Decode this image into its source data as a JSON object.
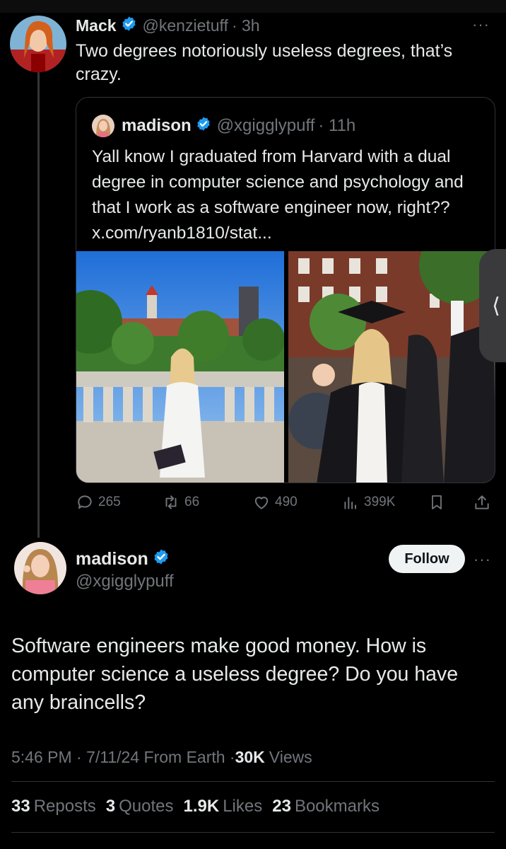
{
  "colors": {
    "accent": "#1d9bf0",
    "text": "#e7e9ea",
    "muted": "#71767b",
    "border": "#2f3336",
    "background": "#000000"
  },
  "tweet1": {
    "name": "Mack",
    "handle": "@kenzietuff",
    "time": "· 3h",
    "more": "···",
    "text": "Two degrees notoriously useless degrees, that’s crazy."
  },
  "quote": {
    "name": "madison",
    "handle": "@xgigglypuff",
    "time": "· 11h",
    "text": "Yall know I graduated from Harvard with a dual degree in computer science and psychology and that I work as a software engineer now, right?? x.com/ryanb1810/stat..."
  },
  "actions": {
    "replies": "265",
    "reposts": "66",
    "likes": "490",
    "views": "399K",
    "icons": [
      "reply-icon",
      "repost-icon",
      "like-icon",
      "views-icon",
      "bookmark-icon",
      "share-icon"
    ]
  },
  "tweet2": {
    "name": "madison",
    "handle": "@xgigglypuff",
    "follow_label": "Follow",
    "more": "···",
    "text": "Software engineers make good money. How is computer science a useless degree? Do you have any braincells?",
    "time": "5:46 PM · 7/11/24 From Earth · ",
    "views_count": "30K",
    "views_label": "Views"
  },
  "stats": {
    "reposts_count": "33",
    "reposts_label": "Reposts",
    "quotes_count": "3",
    "quotes_label": "Quotes",
    "likes_count": "1.9K",
    "likes_label": "Likes",
    "bookmarks_count": "23",
    "bookmarks_label": "Bookmarks"
  },
  "side_tab": {
    "glyph": "⟨"
  }
}
